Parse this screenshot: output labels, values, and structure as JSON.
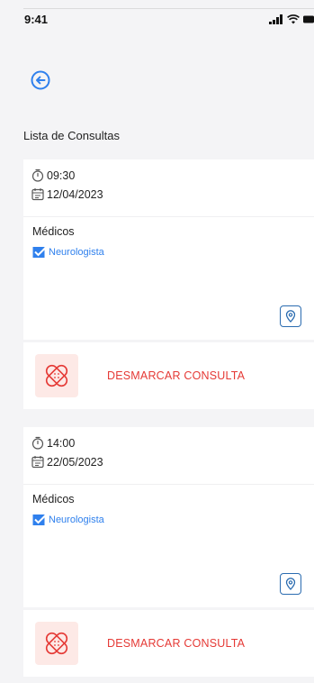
{
  "status_bar": {
    "time": "9:41"
  },
  "header": {
    "title": "Lista de Consultas"
  },
  "appointments": [
    {
      "time": "09:30",
      "date": "12/04/2023",
      "doctors_label": "Médicos",
      "specialty": "Neurologista",
      "cancel_label": "DESMARCAR CONSULTA"
    },
    {
      "time": "14:00",
      "date": "22/05/2023",
      "doctors_label": "Médicos",
      "specialty": "Neurologista",
      "cancel_label": "DESMARCAR CONSULTA"
    }
  ],
  "colors": {
    "accent": "#2f80ed",
    "danger": "#e53935",
    "danger_bg": "#fde9e6",
    "map_border": "#2b6cb0"
  }
}
